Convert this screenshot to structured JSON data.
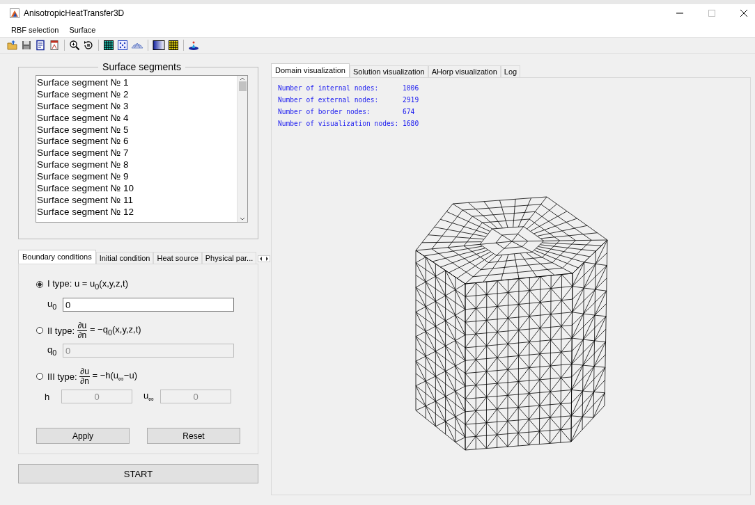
{
  "window": {
    "title": "AnisotropicHeatTransfer3D"
  },
  "menu": [
    "RBF selection",
    "Surface"
  ],
  "segments": {
    "title": "Surface segments",
    "items": [
      {
        "label": "Surface segment № 1",
        "selected": false
      },
      {
        "label": "Surface segment № 2",
        "selected": false
      },
      {
        "label": "Surface segment № 3",
        "selected": false
      },
      {
        "label": "Surface segment № 4",
        "selected": false
      },
      {
        "label": "Surface segment № 5",
        "selected": false
      },
      {
        "label": "Surface segment № 6",
        "selected": false
      },
      {
        "label": "Surface segment № 7",
        "selected": false
      },
      {
        "label": "Surface segment № 8",
        "selected": false
      },
      {
        "label": "Surface segment № 9",
        "selected": false
      },
      {
        "label": "Surface segment № 10",
        "selected": false
      },
      {
        "label": "Surface segment № 11",
        "selected": false
      },
      {
        "label": "Surface segment № 12",
        "selected": false
      }
    ]
  },
  "settings_tabs": [
    {
      "label": "Boundary conditions",
      "selected": true
    },
    {
      "label": "Initial condition",
      "selected": false
    },
    {
      "label": "Heat source",
      "selected": false
    },
    {
      "label": "Physical par...",
      "selected": false
    }
  ],
  "conditions": [
    {
      "kind": "plain",
      "label": "I type: u = u$_{0}$(x,y,z,t)",
      "selected": true,
      "fields": [
        {
          "label": "u$_{0}$",
          "value": "0",
          "disabled": false
        }
      ]
    },
    {
      "kind": "derivative",
      "prefix": "II type:",
      "numerator": "∂u",
      "denominator": "∂n",
      "rhs": "= −q$_{0}$(x,y,z,t)",
      "selected": false,
      "fields": [
        {
          "label": "q$_{0}$",
          "value": "0",
          "disabled": true
        }
      ]
    },
    {
      "kind": "derivative",
      "prefix": "III type:",
      "numerator": "∂u",
      "denominator": "∂n",
      "rhs": "= −h(u$_{∞}$−u)",
      "selected": false,
      "fields": [
        {
          "label": "h",
          "value": "0",
          "disabled": true
        },
        {
          "label": "u$_{∞}$",
          "value": "0",
          "disabled": true
        }
      ]
    }
  ],
  "buttons": [
    "Apply",
    "Reset"
  ],
  "start_button": "START",
  "view_tabs": [
    {
      "label": "Domain visualization",
      "selected": true
    },
    {
      "label": "Solution visualization",
      "selected": false
    },
    {
      "label": "AHorp visualization",
      "selected": false
    },
    {
      "label": "Log",
      "selected": false
    }
  ],
  "stats": [
    "Number of internal nodes:      1006",
    "Number of external nodes:      2919",
    "Number of border nodes:        674",
    "Number of visualization nodes: 1680"
  ]
}
